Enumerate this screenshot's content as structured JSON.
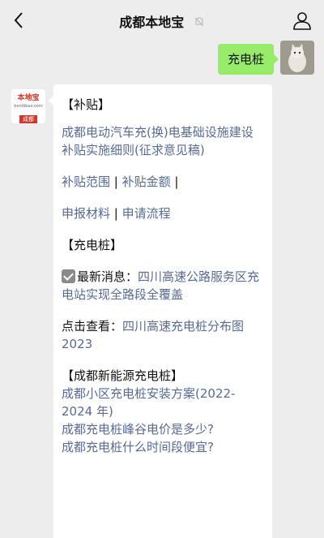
{
  "header": {
    "title": "成都本地宝",
    "back_icon": "chevron-left-icon",
    "mute_icon": "bell-off-icon",
    "user_icon": "person-icon"
  },
  "outgoing": {
    "text": "充电桩"
  },
  "bot_avatar": {
    "line1": "本地宝",
    "line2": "bendibao.com",
    "line3": "成都"
  },
  "reply": {
    "section1": "【补贴】",
    "policy_link": "成都电动汽车充(换)电基础设施建设补贴实施细则(征求意见稿)",
    "links_row1": [
      "补贴范围",
      "补贴金额"
    ],
    "links_row2": [
      "申报材料",
      "申请流程"
    ],
    "sep": " | ",
    "section2": "【充电桩】",
    "news_label": "最新消息：",
    "news_link": "四川高速公路服务区充电站实现全路段全覆盖",
    "view_label": "点击查看：",
    "view_link": "四川高速充电桩分布图2023",
    "section3": "【成都新能源充电桩】",
    "more_links": [
      "成都小区充电桩安装方案(2022-2024 年)",
      "成都充电桩峰谷电价是多少?",
      "成都充电桩什么时间段便宜?"
    ]
  },
  "colors": {
    "background": "#ededed",
    "outgoing_bubble": "#95ec69",
    "link": "#576b95",
    "brand_red": "#d3382c"
  }
}
